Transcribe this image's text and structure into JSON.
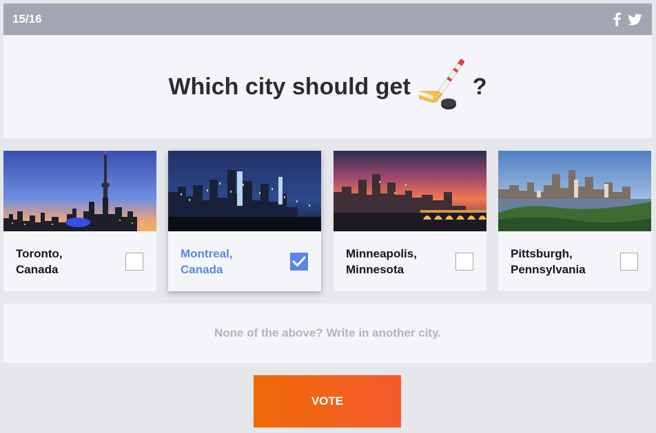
{
  "header": {
    "counter": "15/16",
    "share_icons": [
      "facebook-icon",
      "twitter-icon"
    ]
  },
  "question": {
    "text": "Which city should get",
    "emoji_icon": "hockey-stick-puck-icon",
    "suffix": "?"
  },
  "options": [
    {
      "line1": "Toronto,",
      "line2": "Canada",
      "selected": false
    },
    {
      "line1": "Montreal,",
      "line2": "Canada",
      "selected": true
    },
    {
      "line1": "Minneapolis,",
      "line2": "Minnesota",
      "selected": false
    },
    {
      "line1": "Pittsburgh,",
      "line2": "Pennsylvania",
      "selected": false
    }
  ],
  "writein": {
    "placeholder": "None of the above? Write in another city."
  },
  "vote": {
    "label": "VOTE"
  },
  "colors": {
    "header_bar": "#a4a5b2",
    "selected_accent": "#5b86e5",
    "vote_start": "#ef6a05",
    "vote_end": "#f55a2e"
  }
}
